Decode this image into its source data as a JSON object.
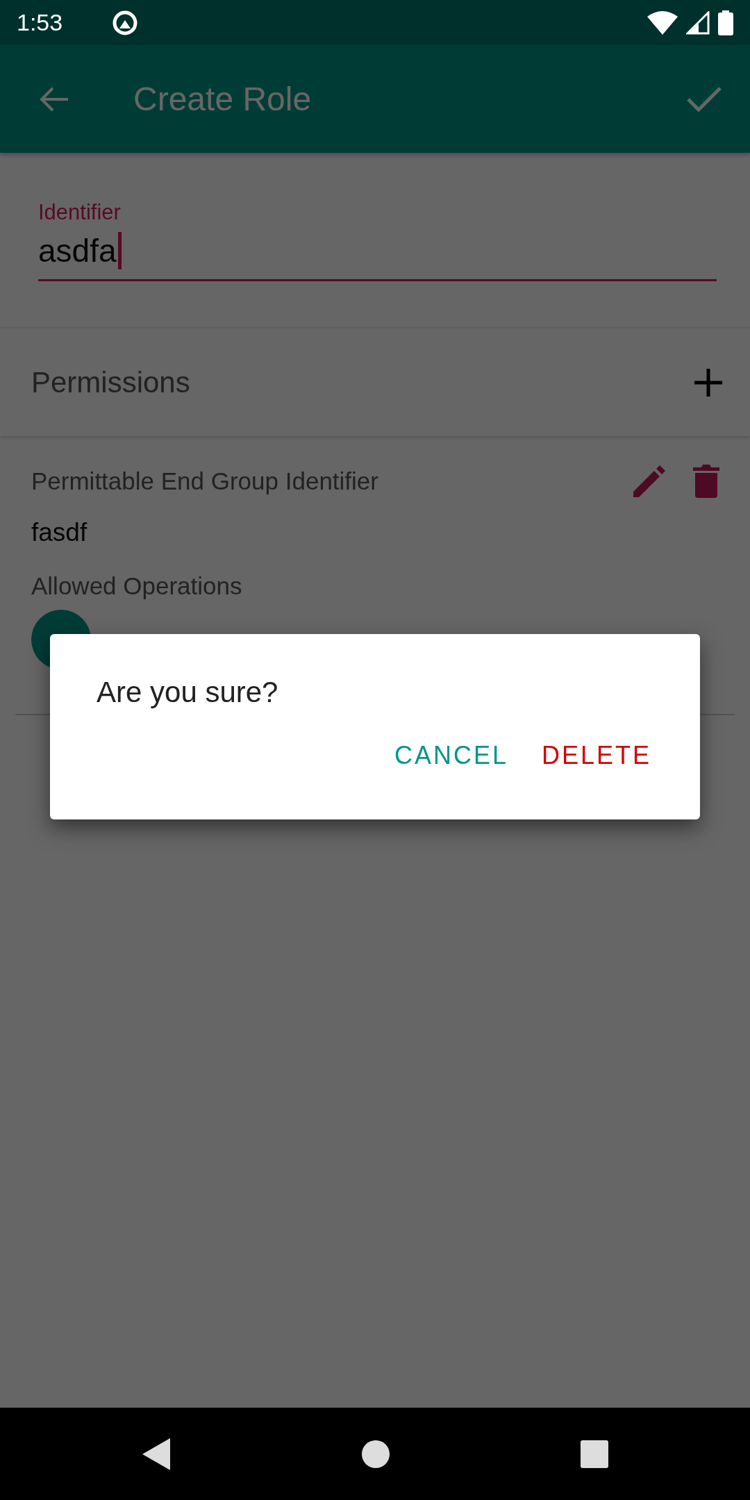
{
  "status_bar": {
    "time": "1:53"
  },
  "app_bar": {
    "title": "Create Role"
  },
  "identifier_field": {
    "label": "Identifier",
    "value": "asdfa",
    "focused": true
  },
  "permissions_header": {
    "title": "Permissions"
  },
  "permissions": [
    {
      "label": "Permittable End Group Identifier",
      "value": "fasdf",
      "operations_label": "Allowed Operations"
    }
  ],
  "dialog": {
    "message": "Are you sure?",
    "buttons": [
      {
        "label": "CANCEL",
        "kind": "neutral"
      },
      {
        "label": "DELETE",
        "kind": "destructive"
      }
    ]
  }
}
